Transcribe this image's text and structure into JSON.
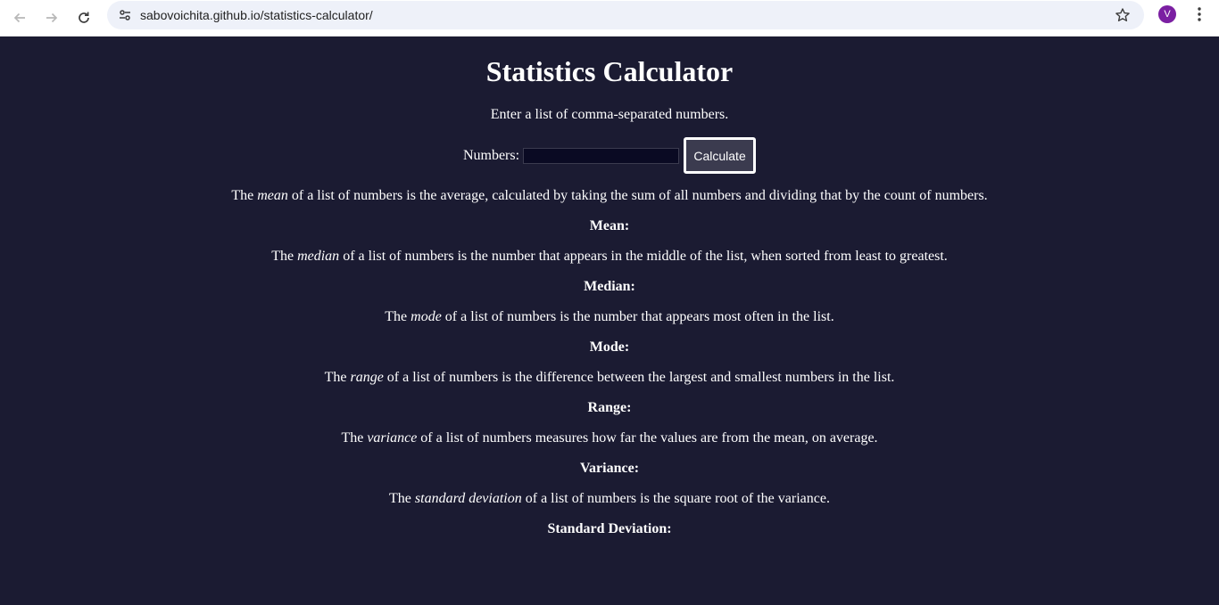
{
  "browser": {
    "url": "sabovoichita.github.io/statistics-calculator/",
    "avatar_initial": "V"
  },
  "page": {
    "title": "Statistics Calculator",
    "intro": "Enter a list of comma-separated numbers.",
    "numbers_label": "Numbers:",
    "numbers_value": "",
    "calculate_label": "Calculate"
  },
  "definitions": [
    {
      "pre": "The ",
      "term": "mean",
      "post": " of a list of numbers is the average, calculated by taking the sum of all numbers and dividing that by the count of numbers.",
      "result_label": "Mean:"
    },
    {
      "pre": "The ",
      "term": "median",
      "post": " of a list of numbers is the number that appears in the middle of the list, when sorted from least to greatest.",
      "result_label": "Median:"
    },
    {
      "pre": "The ",
      "term": "mode",
      "post": " of a list of numbers is the number that appears most often in the list.",
      "result_label": "Mode:"
    },
    {
      "pre": "The ",
      "term": "range",
      "post": " of a list of numbers is the difference between the largest and smallest numbers in the list.",
      "result_label": "Range:"
    },
    {
      "pre": "The ",
      "term": "variance",
      "post": " of a list of numbers measures how far the values are from the mean, on average.",
      "result_label": "Variance:"
    },
    {
      "pre": "The ",
      "term": "standard deviation",
      "post": " of a list of numbers is the square root of the variance.",
      "result_label": "Standard Deviation:"
    }
  ]
}
